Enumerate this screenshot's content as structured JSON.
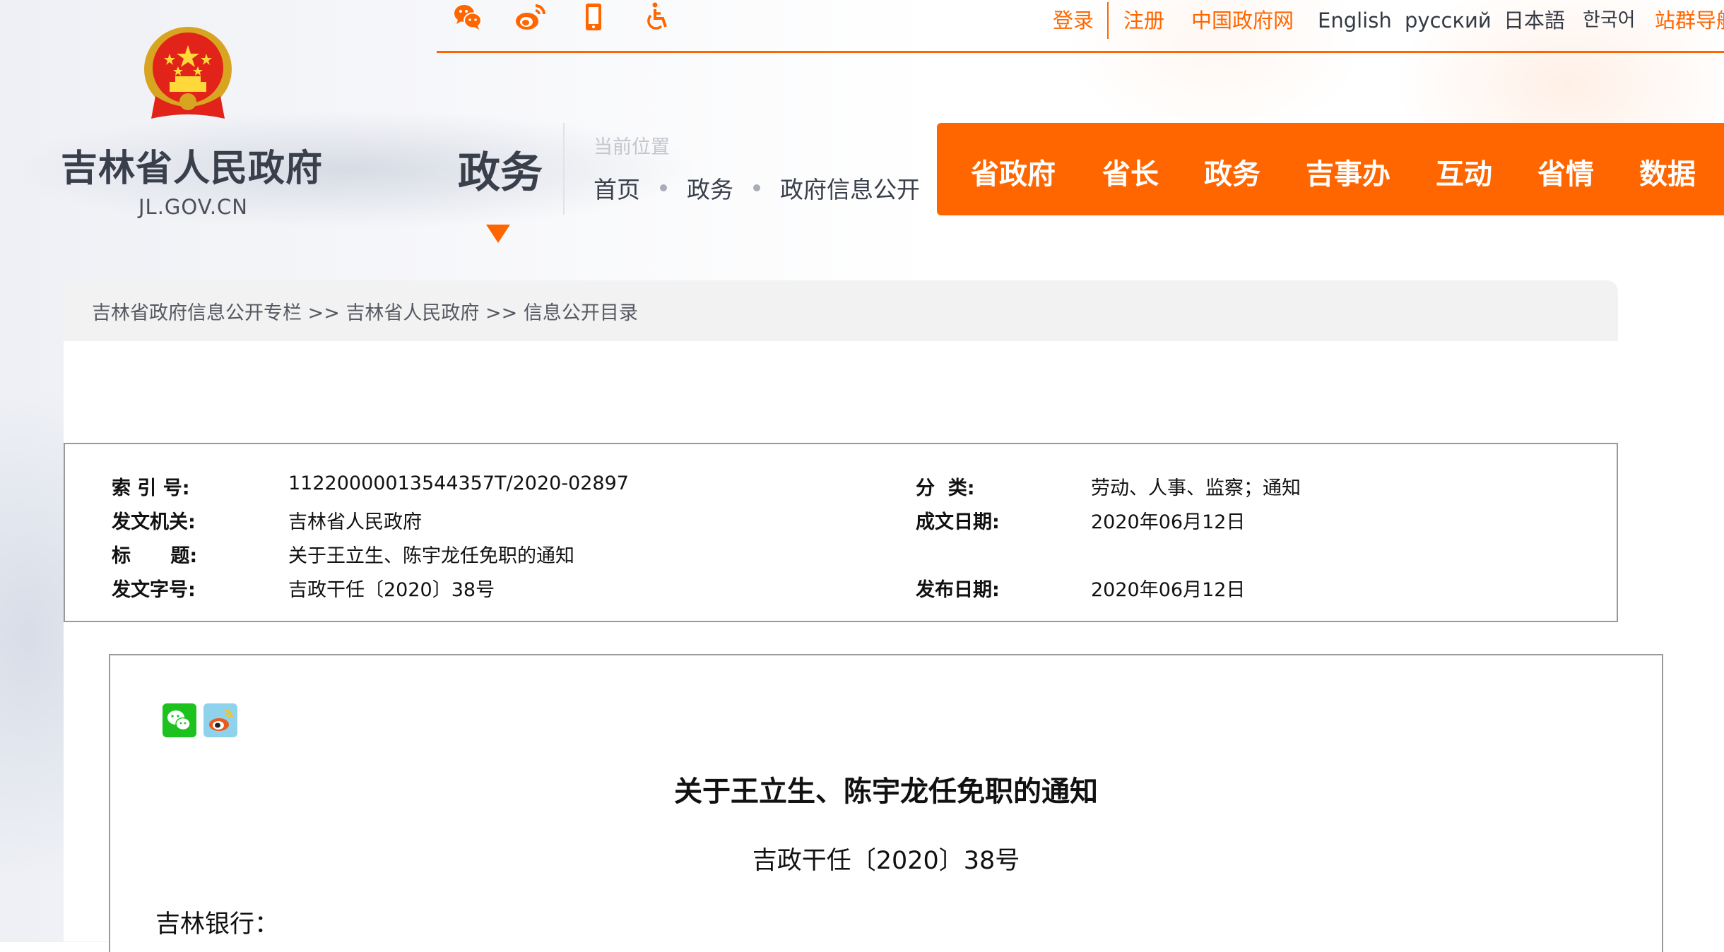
{
  "top_bar": {
    "icons": [
      {
        "name": "wechat-icon"
      },
      {
        "name": "weibo-icon"
      },
      {
        "name": "mobile-icon"
      },
      {
        "name": "accessibility-icon"
      }
    ],
    "links": {
      "login": "登录",
      "register": "注册",
      "china_gov": "中国政府网",
      "english": "English",
      "russian": "русский",
      "japanese": "日本語",
      "korean": "한국어",
      "site_nav": "站群导航"
    }
  },
  "brand": {
    "site_name": "吉林省人民政府",
    "domain": "JL.GOV.CN"
  },
  "section": {
    "title": "政务",
    "location_label": "当前位置",
    "crumbs": [
      "首页",
      "政务",
      "政府信息公开"
    ]
  },
  "main_nav": [
    "省政府",
    "省长",
    "政务",
    "吉事办",
    "互动",
    "省情",
    "数据"
  ],
  "path_bar": {
    "items": [
      "吉林省政府信息公开专栏",
      "吉林省人民政府",
      "信息公开目录"
    ],
    "separator": ">>"
  },
  "info": {
    "index_no": {
      "label": "索 引 号:",
      "value": "11220000013544357T/2020-02897"
    },
    "category": {
      "label": "分  类:",
      "value": "劳动、人事、监察；通知"
    },
    "issuer": {
      "label": "发文机关:",
      "value": "吉林省人民政府"
    },
    "written_date": {
      "label": "成文日期:",
      "value": "2020年06月12日"
    },
    "title": {
      "label": "标      题:",
      "value": "关于王立生、陈宇龙任免职的通知"
    },
    "doc_no": {
      "label": "发文字号:",
      "value": "吉政干任〔2020〕38号"
    },
    "publish_date": {
      "label": "发布日期:",
      "value": "2020年06月12日"
    }
  },
  "document": {
    "share": [
      {
        "name": "wechat-share-icon"
      },
      {
        "name": "weibo-share-icon"
      }
    ],
    "title": "关于王立生、陈宇龙任免职的通知",
    "number": "吉政干任〔2020〕38号",
    "salutation": "吉林银行："
  },
  "colors": {
    "accent": "#ff6600",
    "text_dark": "#3a3f4c",
    "border": "#9a9a9a",
    "path_bg": "#f2f2f2"
  }
}
